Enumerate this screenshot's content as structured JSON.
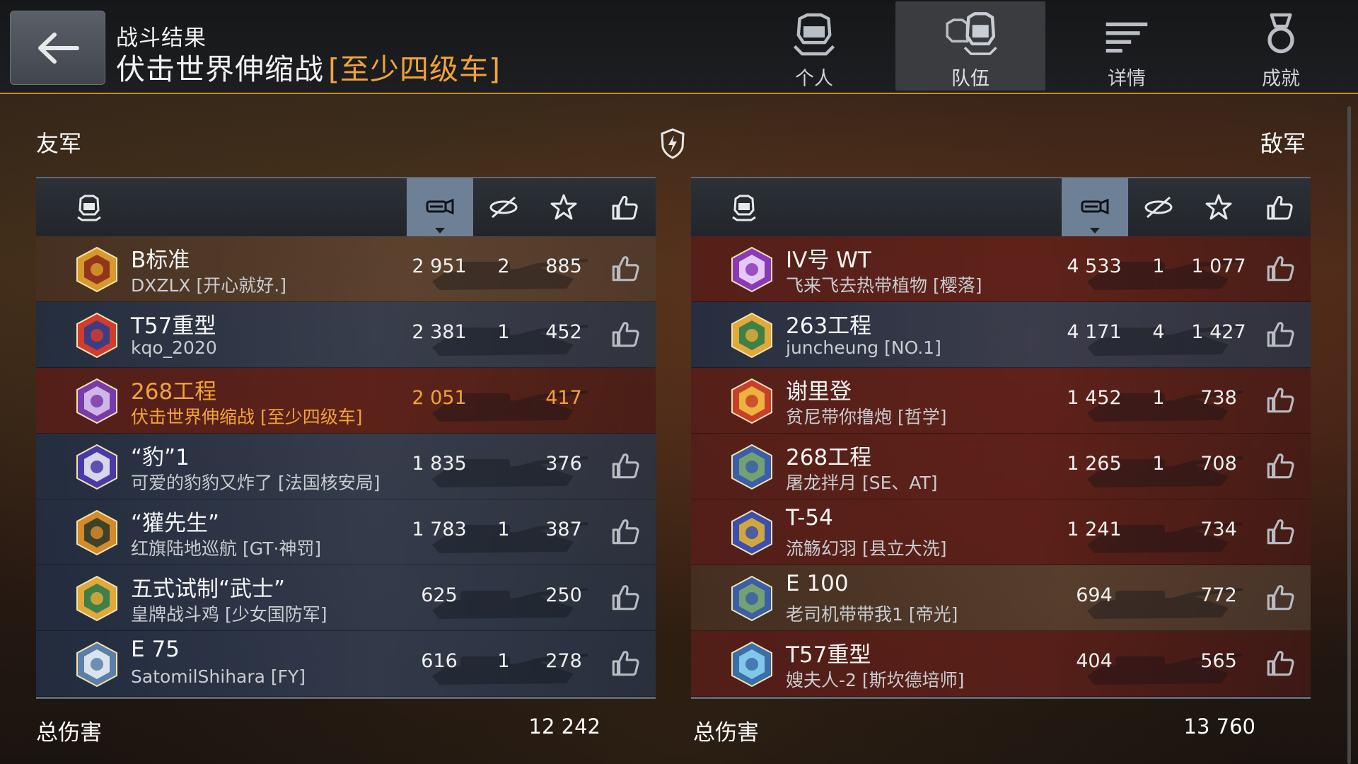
{
  "header": {
    "subtitle": "战斗结果",
    "title": "伏击世界伸缩战",
    "title_tag": "[至少四级车]",
    "tabs": [
      {
        "label": "个人",
        "icon": "helmet-icon",
        "active": false
      },
      {
        "label": "队伍",
        "icon": "team-icon",
        "active": true
      },
      {
        "label": "详情",
        "icon": "list-icon",
        "active": false
      },
      {
        "label": "成就",
        "icon": "medal-icon",
        "active": false
      }
    ]
  },
  "colors": {
    "accent": "#f0a33a",
    "header_border": "#c98a2b",
    "sort_active": "#6e8096"
  },
  "allies": {
    "label": "友军",
    "total_label": "总伤害",
    "total_damage": "12 242",
    "rows": [
      {
        "tank": "B标准",
        "player": "DXZLX [开心就好.]",
        "damage": "2 951",
        "kills": "2",
        "xp": "885",
        "style": "brown",
        "emblem": "gold-emblem-icon",
        "self": false
      },
      {
        "tank": "T57重型",
        "player": "kqo_2020",
        "damage": "2 381",
        "kills": "1",
        "xp": "452",
        "style": "blue",
        "emblem": "season-emblem-icon",
        "self": false
      },
      {
        "tank": "268工程",
        "player": "伏击世界伸缩战 [至少四级车]",
        "damage": "2 051",
        "kills": "",
        "xp": "417",
        "style": "red",
        "emblem": "purple-emblem-icon",
        "self": true
      },
      {
        "tank": "“豹”1",
        "player": "可爱的豹豹又炸了 [法国核安局]",
        "damage": "1 835",
        "kills": "",
        "xp": "376",
        "style": "blue",
        "emblem": "astronaut-emblem-icon",
        "self": false
      },
      {
        "tank": "“獾先生”",
        "player": "红旗陆地巡航 [GT·神罚]",
        "damage": "1 783",
        "kills": "1",
        "xp": "387",
        "style": "blue",
        "emblem": "tank-emblem-icon",
        "self": false
      },
      {
        "tank": "五式试制“武士”",
        "player": "皇牌战斗鸡 [少女国防军]",
        "damage": "625",
        "kills": "",
        "xp": "250",
        "style": "blue",
        "emblem": "gold-star-emblem-icon",
        "self": false
      },
      {
        "tank": "E 75",
        "player": "SatomilShihara [FY]",
        "damage": "616",
        "kills": "1",
        "xp": "278",
        "style": "blue",
        "emblem": "crossed-swords-emblem-icon",
        "self": false
      }
    ]
  },
  "enemies": {
    "label": "敌军",
    "total_label": "总伤害",
    "total_damage": "13 760",
    "rows": [
      {
        "tank": "IV号 WT",
        "player": "飞来飞去热带植物 [樱落]",
        "damage": "4 533",
        "kills": "1",
        "xp": "1 077",
        "style": "red",
        "emblem": "purple-hex-emblem-icon",
        "self": false
      },
      {
        "tank": "263工程",
        "player": "juncheung [NO.1]",
        "damage": "4 171",
        "kills": "4",
        "xp": "1 427",
        "style": "blue",
        "emblem": "gold-star-emblem-icon",
        "self": false
      },
      {
        "tank": "谢里登",
        "player": "贫尼带你撸炮 [哲学]",
        "damage": "1 452",
        "kills": "1",
        "xp": "738",
        "style": "red",
        "emblem": "cartoon-emblem-icon",
        "self": false
      },
      {
        "tank": "268工程",
        "player": "屠龙拌月 [SE、AT]",
        "damage": "1 265",
        "kills": "1",
        "xp": "708",
        "style": "red",
        "emblem": "portrait-emblem-icon",
        "self": false
      },
      {
        "tank": "T-54",
        "player": "流觞幻羽 [县立大洗]",
        "damage": "1 241",
        "kills": "",
        "xp": "734",
        "style": "red",
        "emblem": "bull-emblem-icon",
        "self": false
      },
      {
        "tank": "E 100",
        "player": "老司机带带我1 [帝光]",
        "damage": "694",
        "kills": "",
        "xp": "772",
        "style": "brown",
        "emblem": "portrait-emblem-icon",
        "self": false
      },
      {
        "tank": "T57重型",
        "player": "嫂夫人-2 [斯坎德培师]",
        "damage": "404",
        "kills": "",
        "xp": "565",
        "style": "red",
        "emblem": "wolf-emblem-icon",
        "self": false
      }
    ]
  }
}
